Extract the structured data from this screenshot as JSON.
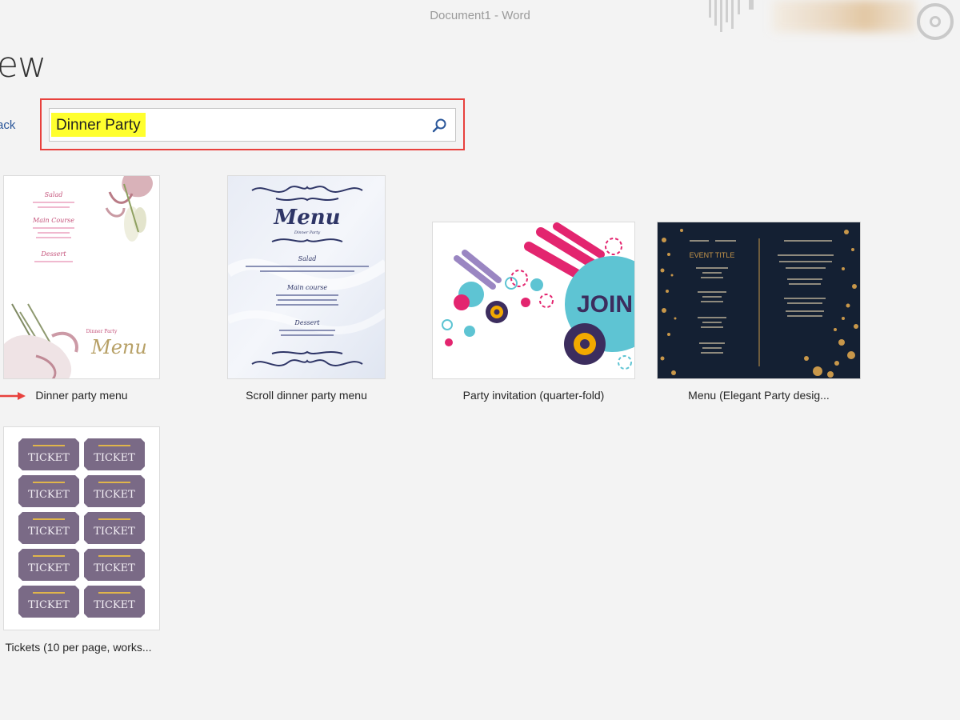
{
  "window": {
    "title": "Document1  -  Word"
  },
  "page": {
    "heading": "ew",
    "back_label": "ack"
  },
  "search": {
    "value": "Dinner Party",
    "icon": "search-icon"
  },
  "templates": [
    {
      "label": "Dinner party menu",
      "thumb_texts": [
        "Salad",
        "Main Course",
        "Dessert",
        "Dinner Party",
        "Menu"
      ]
    },
    {
      "label": "Scroll dinner party menu",
      "thumb_texts": [
        "Menu",
        "Dinner Party",
        "Salad",
        "Main course",
        "Dessert"
      ]
    },
    {
      "label": "Party invitation (quarter-fold)",
      "thumb_texts": [
        "JOIN"
      ]
    },
    {
      "label": "Menu (Elegant Party desig...",
      "thumb_texts": [
        "EVENT TITLE"
      ]
    },
    {
      "label": "Tickets (10 per page, works...",
      "thumb_texts": [
        "TICKET"
      ]
    }
  ],
  "colors": {
    "accent": "#2b579a",
    "highlight_border": "#e8413d",
    "search_highlight": "#ffff2e"
  }
}
